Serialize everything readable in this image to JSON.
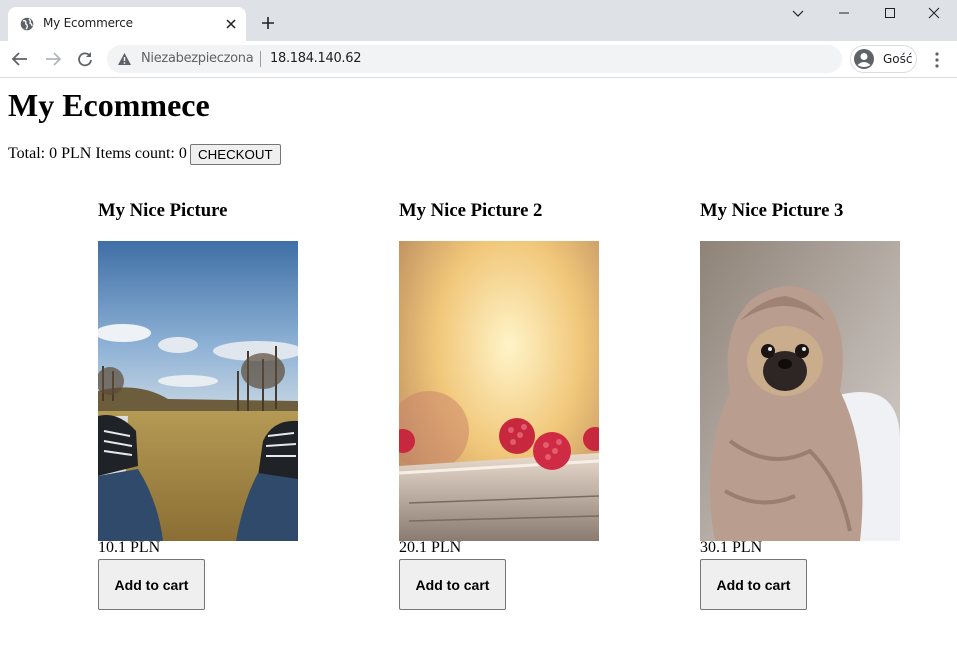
{
  "browser": {
    "tab_title": "My Ecommerce",
    "security_label": "Niezabezpieczona",
    "url": "18.184.140.62",
    "profile_name": "Gość",
    "icons": [
      "globe-icon",
      "close-icon",
      "plus-icon",
      "chevron-down-icon",
      "minimize-icon",
      "maximize-icon",
      "window-close-icon",
      "back-arrow-icon",
      "forward-arrow-icon",
      "reload-icon",
      "warning-icon",
      "avatar-icon",
      "menu-dots-icon"
    ]
  },
  "page": {
    "title": "My Ecommece",
    "total_label": "Total: 0 PLN Items count: 0",
    "checkout_label": "CHECKOUT"
  },
  "products": [
    {
      "name": "My Nice Picture",
      "price": "10.1 PLN",
      "button": "Add to cart",
      "image": "sneakers-on-field"
    },
    {
      "name": "My Nice Picture 2",
      "price": "20.1 PLN",
      "button": "Add to cart",
      "image": "raspberries"
    },
    {
      "name": "My Nice Picture 3",
      "price": "30.1 PLN",
      "button": "Add to cart",
      "image": "pug-in-blanket"
    }
  ]
}
